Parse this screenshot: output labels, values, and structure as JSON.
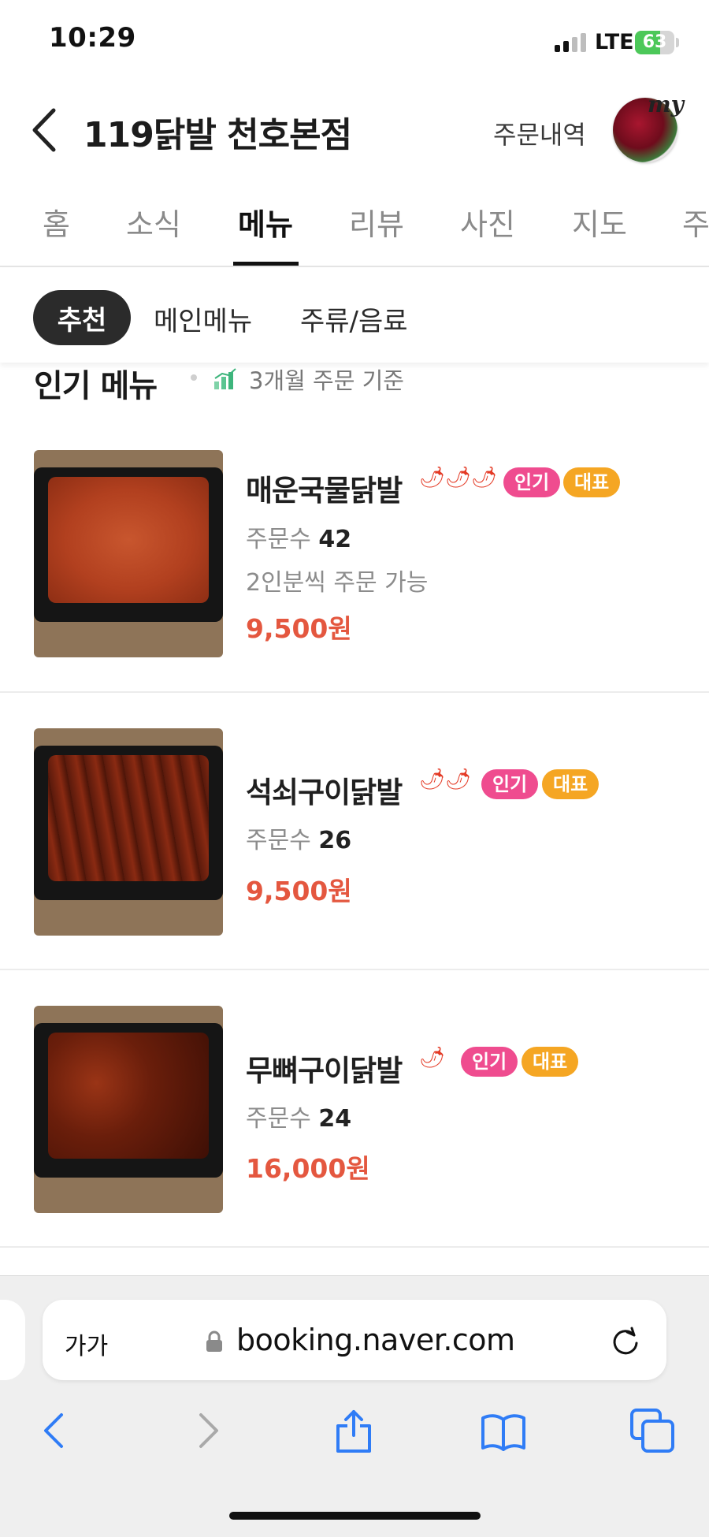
{
  "status_bar": {
    "time": "10:29",
    "network": "LTE",
    "battery": "63",
    "battery_level": 0.63
  },
  "header": {
    "title": "119닭발 천호본점",
    "order_history": "주문내역",
    "avatar_text": "my"
  },
  "tabs": [
    "홈",
    "소식",
    "메뉴",
    "리뷰",
    "사진",
    "지도",
    "주"
  ],
  "active_tab": "메뉴",
  "categories": {
    "active": "추천",
    "items": [
      "메인메뉴",
      "주류/음료"
    ]
  },
  "section": {
    "title": "인기 메뉴",
    "subtitle": "3개월 주문 기준"
  },
  "menu_items": [
    {
      "name": "매운국물닭발",
      "peppers": 3,
      "badge_popular": "인기",
      "badge_main": "대표",
      "orders_label": "주문수",
      "orders_count": "42",
      "note": "2인분씩 주문 가능",
      "price": "9,500원"
    },
    {
      "name": "석쇠구이닭발",
      "peppers": 2,
      "badge_popular": "인기",
      "badge_main": "대표",
      "orders_label": "주문수",
      "orders_count": "26",
      "price": "9,500원"
    },
    {
      "name": "무뼈구이닭발",
      "peppers": 1,
      "badge_popular": "인기",
      "badge_main": "대표",
      "orders_label": "주문수",
      "orders_count": "24",
      "price": "16,000원"
    }
  ],
  "browser": {
    "text_size": "가가",
    "url": "booking.naver.com"
  },
  "colors": {
    "price": "#e4573f",
    "badge_popular": "#ef4c8f",
    "badge_main": "#f5a623",
    "ios_blue": "#2f7cf6"
  }
}
